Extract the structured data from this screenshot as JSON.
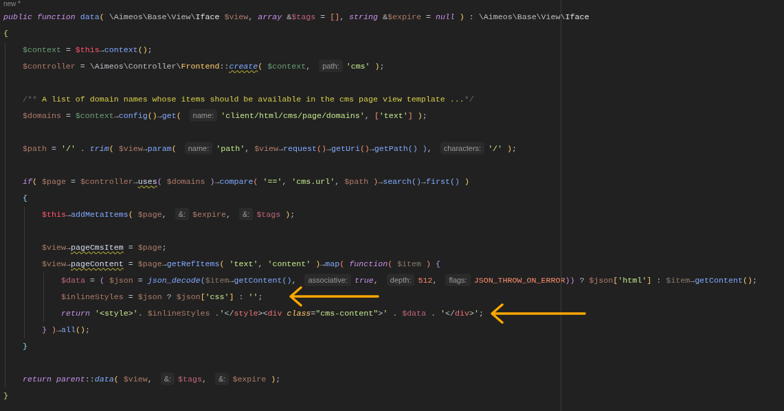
{
  "tab": {
    "label": "new *"
  },
  "lines": [
    {
      "kind": "code",
      "tokens": [
        {
          "kind": "kw",
          "text": "public function "
        },
        {
          "kind": "fn",
          "text": "data"
        },
        {
          "kind": "by",
          "text": "( "
        },
        {
          "kind": "p",
          "text": "\\Aimeos\\Base\\View\\"
        },
        {
          "kind": "cls",
          "text": "Iface "
        },
        {
          "kind": "c",
          "color": "#b07c6a",
          "text": "$view"
        },
        {
          "kind": "p",
          "text": ", "
        },
        {
          "kind": "kw",
          "text": "array "
        },
        {
          "kind": "p",
          "text": "&"
        },
        {
          "kind": "c",
          "color": "#c0677b",
          "text": "$tags"
        },
        {
          "kind": "p",
          "text": " = "
        },
        {
          "kind": "bo",
          "text": "[]"
        },
        {
          "kind": "p",
          "text": ", "
        },
        {
          "kind": "kw",
          "text": "string "
        },
        {
          "kind": "p",
          "text": "&"
        },
        {
          "kind": "c",
          "color": "#b07c6a",
          "text": "$expire"
        },
        {
          "kind": "p",
          "text": " = "
        },
        {
          "kind": "kw",
          "text": "null "
        },
        {
          "kind": "by",
          "text": ")"
        },
        {
          "kind": "p",
          "text": " : \\Aimeos\\Base\\View\\"
        },
        {
          "kind": "cls",
          "text": "Iface"
        }
      ]
    },
    {
      "kind": "code",
      "tokens": [
        {
          "kind": "bg",
          "text": "{"
        }
      ],
      "children": [
        {
          "kind": "code",
          "tokens": [
            {
              "kind": "c",
              "color": "#6a9f75",
              "text": "$context"
            },
            {
              "kind": "p",
              "text": " = "
            },
            {
              "kind": "c",
              "color": "#ff5370",
              "text": "$this"
            },
            {
              "kind": "p",
              "text": "→"
            },
            {
              "kind": "fn",
              "text": "context"
            },
            {
              "kind": "by",
              "text": "()"
            },
            {
              "kind": "p",
              "text": ";"
            }
          ]
        },
        {
          "kind": "code",
          "tokens": [
            {
              "kind": "c",
              "color": "#b07c6a",
              "text": "$controller"
            },
            {
              "kind": "p",
              "text": " = \\Aimeos\\Controller\\"
            },
            {
              "kind": "ns",
              "text": "Frontend"
            },
            {
              "kind": "p",
              "text": "::"
            },
            {
              "kind": "warni",
              "text": "create"
            },
            {
              "kind": "by",
              "text": "( "
            },
            {
              "kind": "c",
              "color": "#6a9f75",
              "text": "$context"
            },
            {
              "kind": "p",
              "text": ", "
            },
            {
              "kind": "hint",
              "text": "path:"
            },
            {
              "kind": "str",
              "text": "'cms' "
            },
            {
              "kind": "by",
              "text": ")"
            },
            {
              "kind": "p",
              "text": ";"
            }
          ]
        },
        {
          "kind": "blank"
        },
        {
          "kind": "code",
          "tokens": [
            {
              "kind": "cmtd",
              "text": "/**"
            },
            {
              "kind": "cmt",
              "text": " A list of domain names whose items should be available in the cms page view template ..."
            },
            {
              "kind": "cmtd",
              "text": "*/"
            }
          ]
        },
        {
          "kind": "code",
          "tokens": [
            {
              "kind": "c",
              "color": "#b07c6a",
              "text": "$domains"
            },
            {
              "kind": "p",
              "text": " = "
            },
            {
              "kind": "c",
              "color": "#6a9f75",
              "text": "$context"
            },
            {
              "kind": "p",
              "text": "→"
            },
            {
              "kind": "fn",
              "text": "config"
            },
            {
              "kind": "by",
              "text": "()"
            },
            {
              "kind": "p",
              "text": "→"
            },
            {
              "kind": "fn",
              "text": "get"
            },
            {
              "kind": "by",
              "text": "( "
            },
            {
              "kind": "hint",
              "text": "name:"
            },
            {
              "kind": "str",
              "text": "'client/html/cms/page/domains'"
            },
            {
              "kind": "p",
              "text": ", "
            },
            {
              "kind": "bo",
              "text": "["
            },
            {
              "kind": "str",
              "text": "'text'"
            },
            {
              "kind": "bo",
              "text": "] "
            },
            {
              "kind": "by",
              "text": ")"
            },
            {
              "kind": "p",
              "text": ";"
            }
          ]
        },
        {
          "kind": "blank"
        },
        {
          "kind": "code",
          "tokens": [
            {
              "kind": "c",
              "color": "#b07c6a",
              "text": "$path"
            },
            {
              "kind": "p",
              "text": " = "
            },
            {
              "kind": "str",
              "text": "'/'"
            },
            {
              "kind": "p",
              "text": " . "
            },
            {
              "kind": "fni",
              "text": "trim"
            },
            {
              "kind": "by",
              "text": "( "
            },
            {
              "kind": "c",
              "color": "#b07c6a",
              "text": "$view"
            },
            {
              "kind": "p",
              "text": "→"
            },
            {
              "kind": "fn",
              "text": "param"
            },
            {
              "kind": "by",
              "text": "( "
            },
            {
              "kind": "hint",
              "text": "name:"
            },
            {
              "kind": "str",
              "text": "'path'"
            },
            {
              "kind": "p",
              "text": ", "
            },
            {
              "kind": "c",
              "color": "#b07c6a",
              "text": "$view"
            },
            {
              "kind": "p",
              "text": "→"
            },
            {
              "kind": "fn",
              "text": "request"
            },
            {
              "kind": "bo",
              "text": "()"
            },
            {
              "kind": "p",
              "text": "→"
            },
            {
              "kind": "fn",
              "text": "getUri"
            },
            {
              "kind": "bo",
              "text": "()"
            },
            {
              "kind": "p",
              "text": "→"
            },
            {
              "kind": "fn",
              "text": "getPath"
            },
            {
              "kind": "bb",
              "text": "() )"
            },
            {
              "kind": "p",
              "text": ", "
            },
            {
              "kind": "hint",
              "text": "characters:"
            },
            {
              "kind": "str",
              "text": "'/' "
            },
            {
              "kind": "by",
              "text": ")"
            },
            {
              "kind": "p",
              "text": ";"
            }
          ]
        },
        {
          "kind": "blank"
        },
        {
          "kind": "code",
          "tokens": [
            {
              "kind": "kw",
              "text": "if"
            },
            {
              "kind": "by",
              "text": "( "
            },
            {
              "kind": "c",
              "color": "#b07c6a",
              "text": "$page"
            },
            {
              "kind": "p",
              "text": " = "
            },
            {
              "kind": "c",
              "color": "#b07c6a",
              "text": "$controller"
            },
            {
              "kind": "p",
              "text": "→"
            },
            {
              "kind": "warn",
              "text": "uses"
            },
            {
              "kind": "bp",
              "text": "( "
            },
            {
              "kind": "c",
              "color": "#b07c6a",
              "text": "$domains "
            },
            {
              "kind": "bp",
              "text": ")"
            },
            {
              "kind": "p",
              "text": "→"
            },
            {
              "kind": "fn",
              "text": "compare"
            },
            {
              "kind": "bo",
              "text": "( "
            },
            {
              "kind": "str",
              "text": "'=='"
            },
            {
              "kind": "p",
              "text": ", "
            },
            {
              "kind": "str",
              "text": "'cms.url'"
            },
            {
              "kind": "p",
              "text": ", "
            },
            {
              "kind": "c",
              "color": "#b07c6a",
              "text": "$path "
            },
            {
              "kind": "bo",
              "text": ")"
            },
            {
              "kind": "p",
              "text": "→"
            },
            {
              "kind": "fn",
              "text": "search"
            },
            {
              "kind": "bb",
              "text": "()"
            },
            {
              "kind": "p",
              "text": "→"
            },
            {
              "kind": "fn",
              "text": "first"
            },
            {
              "kind": "bb",
              "text": "() "
            },
            {
              "kind": "by",
              "text": ")"
            }
          ]
        },
        {
          "kind": "code",
          "tokens": [
            {
              "kind": "bc",
              "text": "{"
            }
          ],
          "children": [
            {
              "kind": "code",
              "tokens": [
                {
                  "kind": "c",
                  "color": "#ff5370",
                  "text": "$this"
                },
                {
                  "kind": "p",
                  "text": "→"
                },
                {
                  "kind": "fn",
                  "text": "addMetaItems"
                },
                {
                  "kind": "by",
                  "text": "( "
                },
                {
                  "kind": "c",
                  "color": "#b07c6a",
                  "text": "$page"
                },
                {
                  "kind": "p",
                  "text": ", "
                },
                {
                  "kind": "hint",
                  "text": "&:"
                },
                {
                  "kind": "c",
                  "color": "#b07c6a",
                  "text": "$expire"
                },
                {
                  "kind": "p",
                  "text": ", "
                },
                {
                  "kind": "hint",
                  "text": "&:"
                },
                {
                  "kind": "c",
                  "color": "#c0677b",
                  "text": "$tags "
                },
                {
                  "kind": "by",
                  "text": ")"
                },
                {
                  "kind": "p",
                  "text": ";"
                }
              ]
            },
            {
              "kind": "blank"
            },
            {
              "kind": "code",
              "tokens": [
                {
                  "kind": "c",
                  "color": "#b07c6a",
                  "text": "$view"
                },
                {
                  "kind": "p",
                  "text": "→"
                },
                {
                  "kind": "warn",
                  "text": "pageCmsItem"
                },
                {
                  "kind": "p",
                  "text": " = "
                },
                {
                  "kind": "c",
                  "color": "#b07c6a",
                  "text": "$page"
                },
                {
                  "kind": "p",
                  "text": ";"
                }
              ]
            },
            {
              "kind": "code",
              "tokens": [
                {
                  "kind": "c",
                  "color": "#b07c6a",
                  "text": "$view"
                },
                {
                  "kind": "p",
                  "text": "→"
                },
                {
                  "kind": "warn",
                  "text": "pageContent"
                },
                {
                  "kind": "p",
                  "text": " = "
                },
                {
                  "kind": "c",
                  "color": "#b07c6a",
                  "text": "$page"
                },
                {
                  "kind": "p",
                  "text": "→"
                },
                {
                  "kind": "fn",
                  "text": "getRefItems"
                },
                {
                  "kind": "by",
                  "text": "( "
                },
                {
                  "kind": "str",
                  "text": "'text'"
                },
                {
                  "kind": "p",
                  "text": ", "
                },
                {
                  "kind": "str",
                  "text": "'content' "
                },
                {
                  "kind": "by",
                  "text": ")"
                },
                {
                  "kind": "p",
                  "text": "→"
                },
                {
                  "kind": "fn",
                  "text": "map"
                },
                {
                  "kind": "bo",
                  "text": "( "
                },
                {
                  "kind": "kw",
                  "text": "function"
                },
                {
                  "kind": "bo",
                  "text": "( "
                },
                {
                  "kind": "c",
                  "color": "#8a7a6a",
                  "text": "$item "
                },
                {
                  "kind": "bo",
                  "text": ") "
                },
                {
                  "kind": "bp",
                  "text": "{"
                }
              ],
              "children": [
                {
                  "kind": "code",
                  "tokens": [
                    {
                      "kind": "c",
                      "color": "#c0677b",
                      "text": "$data"
                    },
                    {
                      "kind": "p",
                      "text": " = "
                    },
                    {
                      "kind": "bp",
                      "text": "( "
                    },
                    {
                      "kind": "c",
                      "color": "#b07c6a",
                      "text": "$json"
                    },
                    {
                      "kind": "p",
                      "text": " = "
                    },
                    {
                      "kind": "fni",
                      "text": "json_decode"
                    },
                    {
                      "kind": "bb",
                      "text": "("
                    },
                    {
                      "kind": "c",
                      "color": "#8a7a6a",
                      "text": "$item"
                    },
                    {
                      "kind": "p",
                      "text": "→"
                    },
                    {
                      "kind": "fn",
                      "text": "getContent"
                    },
                    {
                      "kind": "bb",
                      "text": "()"
                    },
                    {
                      "kind": "p",
                      "text": ", "
                    },
                    {
                      "kind": "hint",
                      "text": "associative:"
                    },
                    {
                      "kind": "kw",
                      "text": "true"
                    },
                    {
                      "kind": "p",
                      "text": ", "
                    },
                    {
                      "kind": "hint",
                      "text": "depth:"
                    },
                    {
                      "kind": "num",
                      "text": "512"
                    },
                    {
                      "kind": "p",
                      "text": ", "
                    },
                    {
                      "kind": "hint",
                      "text": "flags:"
                    },
                    {
                      "kind": "num",
                      "text": "JSON_THROW_ON_ERROR"
                    },
                    {
                      "kind": "bp",
                      "text": "))"
                    },
                    {
                      "kind": "p",
                      "text": " ? "
                    },
                    {
                      "kind": "c",
                      "color": "#b07c6a",
                      "text": "$json"
                    },
                    {
                      "kind": "by",
                      "text": "["
                    },
                    {
                      "kind": "str",
                      "text": "'html'"
                    },
                    {
                      "kind": "by",
                      "text": "]"
                    },
                    {
                      "kind": "p",
                      "text": " : "
                    },
                    {
                      "kind": "c",
                      "color": "#8a7a6a",
                      "text": "$item"
                    },
                    {
                      "kind": "p",
                      "text": "→"
                    },
                    {
                      "kind": "fn",
                      "text": "getContent"
                    },
                    {
                      "kind": "by",
                      "text": "()"
                    },
                    {
                      "kind": "p",
                      "text": ";"
                    }
                  ]
                },
                {
                  "kind": "code",
                  "tokens": [
                    {
                      "kind": "c",
                      "color": "#b07c6a",
                      "text": "$inlineStyles"
                    },
                    {
                      "kind": "p",
                      "text": " = "
                    },
                    {
                      "kind": "c",
                      "color": "#b07c6a",
                      "text": "$json"
                    },
                    {
                      "kind": "p",
                      "text": " ? "
                    },
                    {
                      "kind": "c",
                      "color": "#b07c6a",
                      "text": "$json"
                    },
                    {
                      "kind": "by",
                      "text": "["
                    },
                    {
                      "kind": "str",
                      "text": "'css'"
                    },
                    {
                      "kind": "by",
                      "text": "]"
                    },
                    {
                      "kind": "p",
                      "text": " : "
                    },
                    {
                      "kind": "str",
                      "text": "''"
                    },
                    {
                      "kind": "p",
                      "text": ";"
                    }
                  ]
                },
                {
                  "kind": "code",
                  "tokens": [
                    {
                      "kind": "kw",
                      "text": "return "
                    },
                    {
                      "kind": "str",
                      "text": "'<style>'"
                    },
                    {
                      "kind": "p",
                      "text": ". "
                    },
                    {
                      "kind": "c",
                      "color": "#b07c6a",
                      "text": "$inlineStyles"
                    },
                    {
                      "kind": "p",
                      "text": " ."
                    },
                    {
                      "kind": "str",
                      "text": "'"
                    },
                    {
                      "kind": "p",
                      "text": "</"
                    },
                    {
                      "kind": "tag",
                      "text": "style"
                    },
                    {
                      "kind": "p",
                      "text": "><"
                    },
                    {
                      "kind": "tag",
                      "text": "div "
                    },
                    {
                      "kind": "attr",
                      "text": "class"
                    },
                    {
                      "kind": "p",
                      "text": "="
                    },
                    {
                      "kind": "str",
                      "text": "\"cms-content\""
                    },
                    {
                      "kind": "p",
                      "text": ">"
                    },
                    {
                      "kind": "str",
                      "text": "'"
                    },
                    {
                      "kind": "p",
                      "text": " . "
                    },
                    {
                      "kind": "c",
                      "color": "#c0677b",
                      "text": "$data"
                    },
                    {
                      "kind": "p",
                      "text": " . "
                    },
                    {
                      "kind": "str",
                      "text": "'"
                    },
                    {
                      "kind": "p",
                      "text": "</"
                    },
                    {
                      "kind": "tag",
                      "text": "div"
                    },
                    {
                      "kind": "p",
                      "text": ">"
                    },
                    {
                      "kind": "str",
                      "text": "'"
                    },
                    {
                      "kind": "p",
                      "text": ";"
                    }
                  ]
                }
              ]
            },
            {
              "kind": "code",
              "tokens": [
                {
                  "kind": "bp",
                  "text": "} "
                },
                {
                  "kind": "bo",
                  "text": ")"
                },
                {
                  "kind": "p",
                  "text": "→"
                },
                {
                  "kind": "fn",
                  "text": "all"
                },
                {
                  "kind": "by",
                  "text": "()"
                },
                {
                  "kind": "p",
                  "text": ";"
                }
              ]
            }
          ]
        },
        {
          "kind": "code",
          "tokens": [
            {
              "kind": "bc",
              "text": "}"
            }
          ]
        },
        {
          "kind": "blank"
        },
        {
          "kind": "code",
          "tokens": [
            {
              "kind": "kw",
              "text": "return parent"
            },
            {
              "kind": "p",
              "text": "::"
            },
            {
              "kind": "fni",
              "text": "data"
            },
            {
              "kind": "by",
              "text": "( "
            },
            {
              "kind": "c",
              "color": "#b07c6a",
              "text": "$view"
            },
            {
              "kind": "p",
              "text": ", "
            },
            {
              "kind": "hint",
              "text": "&:"
            },
            {
              "kind": "c",
              "color": "#c0677b",
              "text": "$tags"
            },
            {
              "kind": "p",
              "text": ", "
            },
            {
              "kind": "hint",
              "text": "&:"
            },
            {
              "kind": "c",
              "color": "#b07c6a",
              "text": "$expire "
            },
            {
              "kind": "by",
              "text": ")"
            },
            {
              "kind": "p",
              "text": ";"
            }
          ]
        }
      ]
    },
    {
      "kind": "code",
      "tokens": [
        {
          "kind": "bg",
          "text": "}"
        }
      ]
    }
  ]
}
